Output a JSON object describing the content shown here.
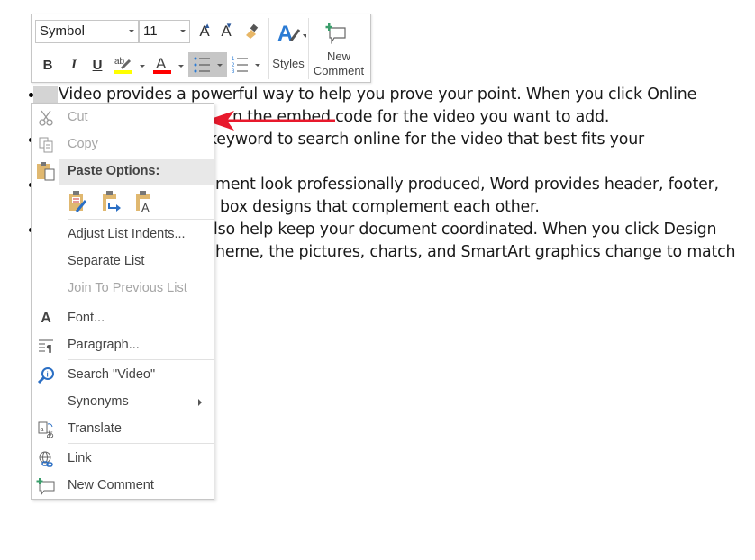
{
  "document": {
    "lines": [
      "Video provides a powerful way to help you prove your point. When you click Online",
      "n the embed code for the video you want to add.",
      "keyword to search online for the video that best fits your",
      "ment look professionally produced, Word provides header, footer,",
      "box designs that complement each other.",
      "lso help keep your document coordinated. When you click Design",
      "heme, the pictures, charts, and SmartArt graphics change to match"
    ]
  },
  "toolbar": {
    "font_name": "Symbol",
    "font_size": "11",
    "grow_font": "A",
    "shrink_font": "A",
    "bold": "B",
    "italic": "I",
    "underline": "U",
    "highlight_color": "#ffff00",
    "font_color": "#ff0000",
    "font_color_glyph": "A",
    "styles_label": "Styles",
    "new_comment_line1": "New",
    "new_comment_line2": "Comment"
  },
  "context_menu": {
    "cut": "Cut",
    "copy": "Copy",
    "paste_options": "Paste Options:",
    "adjust_list_indents": "Adjust List Indents...",
    "separate_list": "Separate List",
    "join_to_previous_list": "Join To Previous List",
    "font": "Font...",
    "paragraph": "Paragraph...",
    "search": "Search \"Video\"",
    "synonyms": "Synonyms",
    "translate": "Translate",
    "link": "Link",
    "new_comment": "New Comment"
  },
  "annotation": {
    "arrow_color": "#e8192c"
  }
}
